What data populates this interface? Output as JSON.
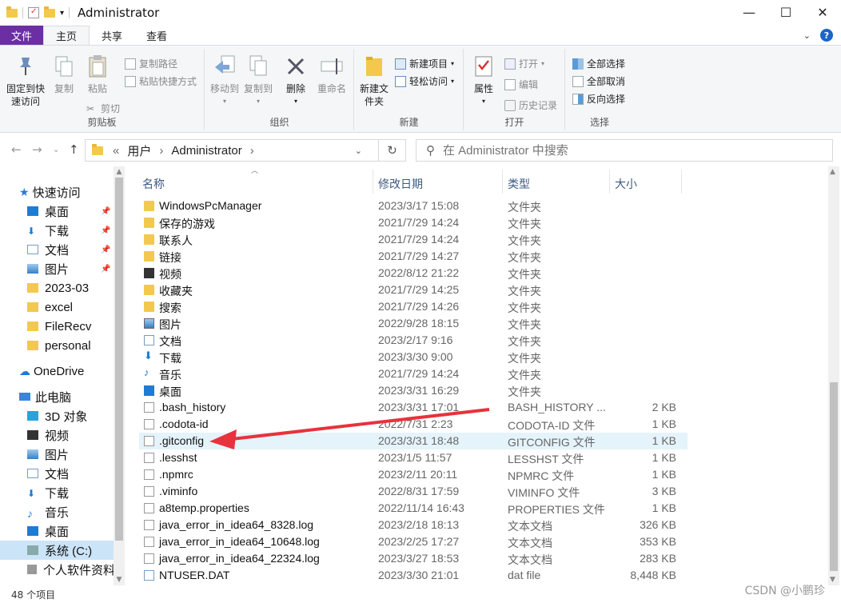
{
  "window": {
    "title": "Administrator",
    "minimize_glyph": "—",
    "maximize_glyph": "☐",
    "close_glyph": "✕"
  },
  "ribbon_tabs": [
    "文件",
    "主页",
    "共享",
    "查看"
  ],
  "ribbon": {
    "clipboard": {
      "label": "剪贴板",
      "pin": "固定到快速访问",
      "copy": "复制",
      "paste": "粘贴",
      "copy_path": "复制路径",
      "paste_shortcut": "粘贴快捷方式",
      "cut": "剪切"
    },
    "organize": {
      "label": "组织",
      "move_to": "移动到",
      "copy_to": "复制到",
      "delete": "删除",
      "rename": "重命名"
    },
    "new": {
      "label": "新建",
      "new_folder": "新建文件夹",
      "new_item": "新建项目",
      "easy_access": "轻松访问"
    },
    "open": {
      "label": "打开",
      "properties": "属性",
      "open": "打开",
      "edit": "编辑",
      "history": "历史记录"
    },
    "select": {
      "label": "选择",
      "select_all": "全部选择",
      "select_none": "全部取消",
      "invert": "反向选择"
    }
  },
  "address": {
    "prefix": "«",
    "segments": [
      "用户",
      "Administrator"
    ],
    "separator": "›",
    "search_placeholder": "在 Administrator 中搜索"
  },
  "nav_pane": {
    "quick_access": "快速访问",
    "quick_items": [
      "桌面",
      "下载",
      "文档",
      "图片",
      "2023-03",
      "excel",
      "FileRecv",
      "personal"
    ],
    "onedrive": "OneDrive",
    "this_pc": "此电脑",
    "pc_items": [
      "3D 对象",
      "视频",
      "图片",
      "文档",
      "下载",
      "音乐",
      "桌面",
      "系统 (C:)",
      "个人软件资料"
    ]
  },
  "columns": {
    "name": "名称",
    "date": "修改日期",
    "type": "类型",
    "size": "大小"
  },
  "files": [
    {
      "name": "WindowsPcManager",
      "date": "2023/3/17 15:08",
      "type": "文件夹",
      "size": "",
      "icon": "folder"
    },
    {
      "name": "保存的游戏",
      "date": "2021/7/29 14:24",
      "type": "文件夹",
      "size": "",
      "icon": "folder"
    },
    {
      "name": "联系人",
      "date": "2021/7/29 14:24",
      "type": "文件夹",
      "size": "",
      "icon": "folder"
    },
    {
      "name": "链接",
      "date": "2021/7/29 14:27",
      "type": "文件夹",
      "size": "",
      "icon": "folder"
    },
    {
      "name": "视频",
      "date": "2022/8/12 21:22",
      "type": "文件夹",
      "size": "",
      "icon": "video"
    },
    {
      "name": "收藏夹",
      "date": "2021/7/29 14:25",
      "type": "文件夹",
      "size": "",
      "icon": "folder"
    },
    {
      "name": "搜索",
      "date": "2021/7/29 14:26",
      "type": "文件夹",
      "size": "",
      "icon": "folder"
    },
    {
      "name": "图片",
      "date": "2022/9/28 18:15",
      "type": "文件夹",
      "size": "",
      "icon": "image"
    },
    {
      "name": "文档",
      "date": "2023/2/17 9:16",
      "type": "文件夹",
      "size": "",
      "icon": "doc"
    },
    {
      "name": "下载",
      "date": "2023/3/30 9:00",
      "type": "文件夹",
      "size": "",
      "icon": "download"
    },
    {
      "name": "音乐",
      "date": "2021/7/29 14:24",
      "type": "文件夹",
      "size": "",
      "icon": "music"
    },
    {
      "name": "桌面",
      "date": "2023/3/31 16:29",
      "type": "文件夹",
      "size": "",
      "icon": "desktop"
    },
    {
      "name": ".bash_history",
      "date": "2023/3/31 17:01",
      "type": "BASH_HISTORY ...",
      "size": "2 KB",
      "icon": "file"
    },
    {
      "name": ".codota-id",
      "date": "2022/7/31 2:23",
      "type": "CODOTA-ID 文件",
      "size": "1 KB",
      "icon": "file"
    },
    {
      "name": ".gitconfig",
      "date": "2023/3/31 18:48",
      "type": "GITCONFIG 文件",
      "size": "1 KB",
      "icon": "file"
    },
    {
      "name": ".lesshst",
      "date": "2023/1/5 11:57",
      "type": "LESSHST 文件",
      "size": "1 KB",
      "icon": "file"
    },
    {
      "name": ".npmrc",
      "date": "2023/2/11 20:11",
      "type": "NPMRC 文件",
      "size": "1 KB",
      "icon": "file"
    },
    {
      "name": ".viminfo",
      "date": "2022/8/31 17:59",
      "type": "VIMINFO 文件",
      "size": "3 KB",
      "icon": "file"
    },
    {
      "name": "a8temp.properties",
      "date": "2022/11/14 16:43",
      "type": "PROPERTIES 文件",
      "size": "1 KB",
      "icon": "file"
    },
    {
      "name": "java_error_in_idea64_8328.log",
      "date": "2023/2/18 18:13",
      "type": "文本文档",
      "size": "326 KB",
      "icon": "text"
    },
    {
      "name": "java_error_in_idea64_10648.log",
      "date": "2023/2/25 17:27",
      "type": "文本文档",
      "size": "353 KB",
      "icon": "text"
    },
    {
      "name": "java_error_in_idea64_22324.log",
      "date": "2023/3/27 18:53",
      "type": "文本文档",
      "size": "283 KB",
      "icon": "text"
    },
    {
      "name": "NTUSER.DAT",
      "date": "2023/3/30 21:01",
      "type": "dat file",
      "size": "8,448 KB",
      "icon": "dat"
    }
  ],
  "highlighted_file": ".gitconfig",
  "annotation_color": "#e8323c",
  "status": {
    "count": "48 个项目"
  },
  "watermark": "CSDN @小鹏珍"
}
